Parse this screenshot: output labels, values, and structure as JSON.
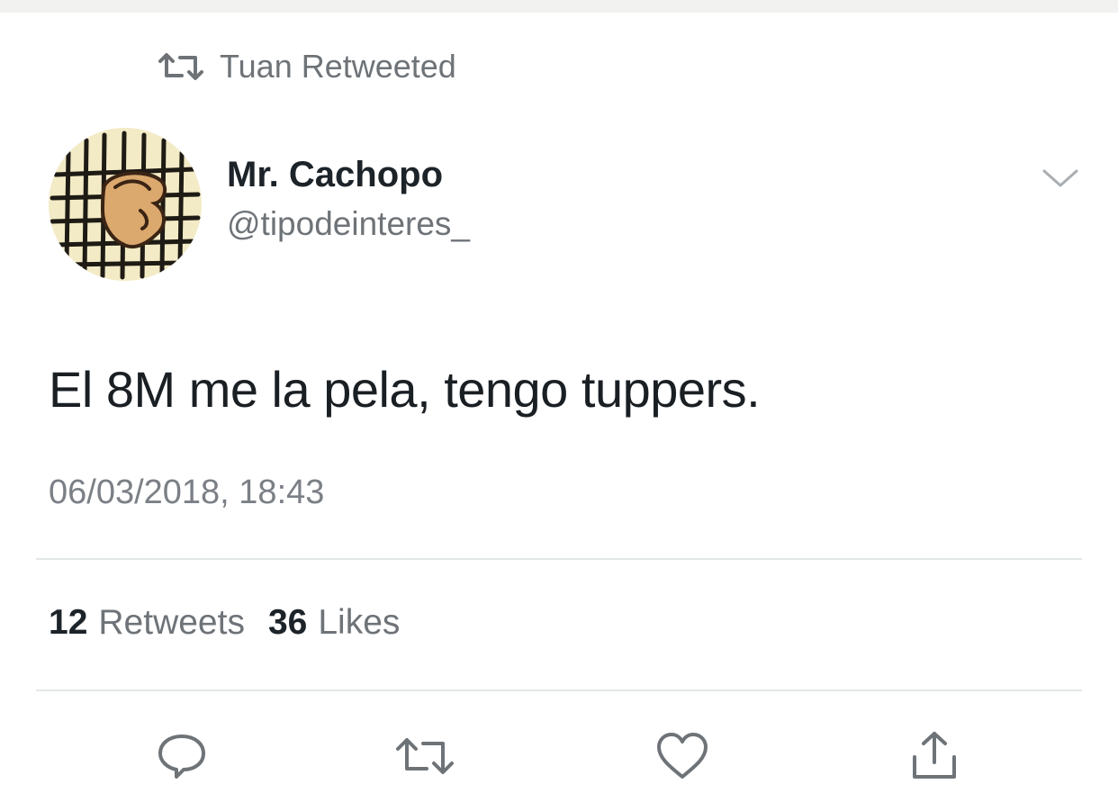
{
  "retweet_context": {
    "icon": "retweet-icon",
    "text": "Tuan Retweeted"
  },
  "tweet": {
    "author": {
      "name": "Mr. Cachopo",
      "handle": "@tipodeinteres_",
      "avatar_icon": "cachopo-avatar"
    },
    "menu_icon": "chevron-down-icon",
    "text": "El 8M me la pela, tengo tuppers.",
    "timestamp": "06/03/2018, 18:43",
    "stats": {
      "retweets_count": "12",
      "retweets_label": "Retweets",
      "likes_count": "36",
      "likes_label": "Likes"
    },
    "actions": [
      {
        "name": "reply",
        "icon": "reply-icon"
      },
      {
        "name": "retweet",
        "icon": "retweet-icon"
      },
      {
        "name": "like",
        "icon": "heart-icon"
      },
      {
        "name": "share",
        "icon": "share-icon"
      }
    ]
  },
  "colors": {
    "text_primary": "#1c2329",
    "text_secondary": "#6e7378",
    "divider": "#e3e6e8",
    "icon": "#6e7378",
    "avatar_background": "#f3ebc6"
  }
}
